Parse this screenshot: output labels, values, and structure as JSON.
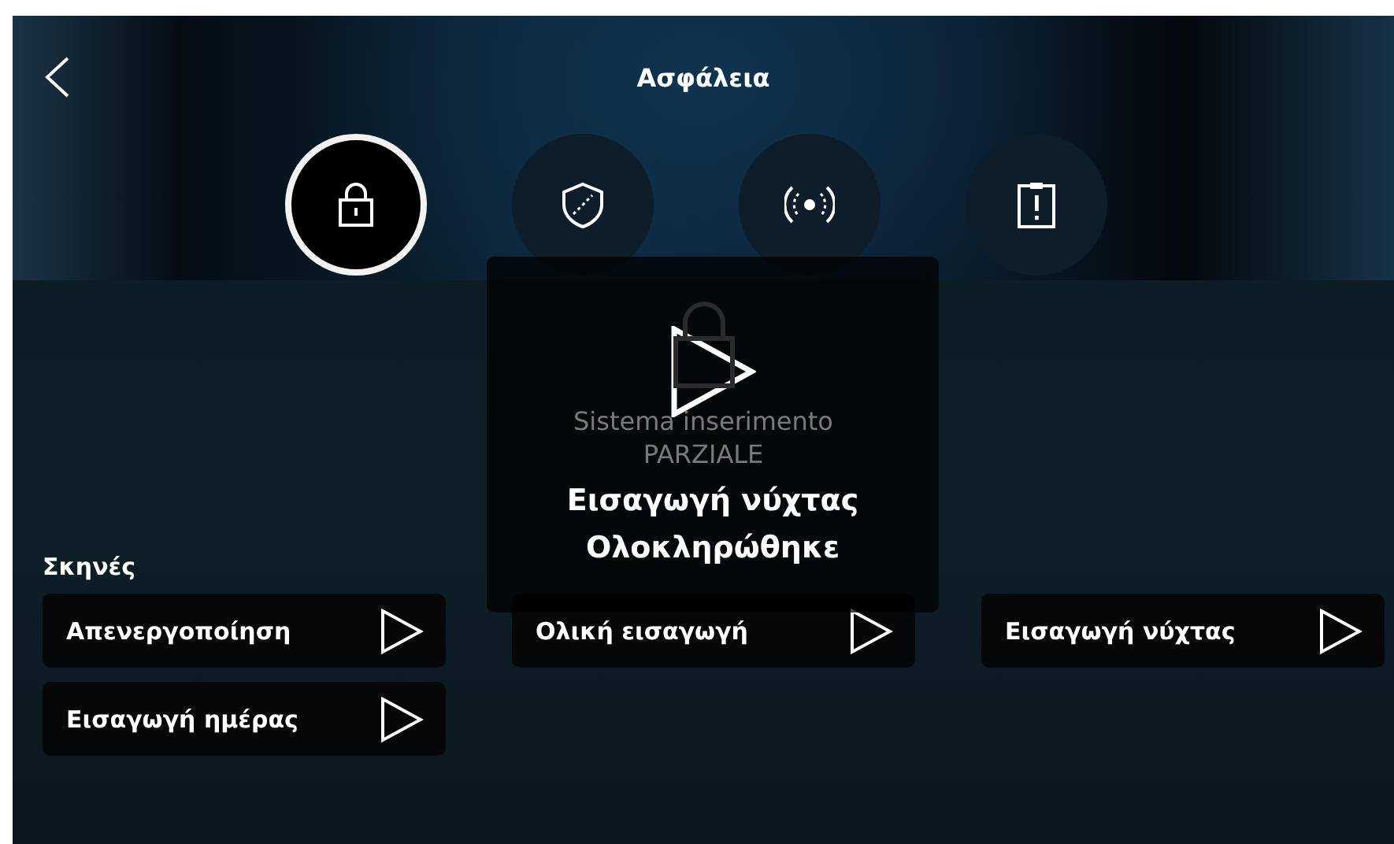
{
  "header": {
    "title": "Ασφάλεια"
  },
  "tabs": [
    {
      "kind": "lock",
      "selected": true
    },
    {
      "kind": "shield",
      "selected": false
    },
    {
      "kind": "signal",
      "selected": false
    },
    {
      "kind": "clipboard",
      "selected": false
    }
  ],
  "status": {
    "lines": [
      "Sistema inserimento",
      "PARZIALE"
    ]
  },
  "scenes": {
    "label": "Σκηνές",
    "columns": [
      {
        "items": [
          {
            "label": "Απενεργοποίηση"
          },
          {
            "label": "Εισαγωγή ημέρας"
          }
        ]
      },
      {
        "items": [
          {
            "label": "Ολική εισαγωγή"
          }
        ]
      },
      {
        "items": [
          {
            "label": "Εισαγωγή νύχτας"
          }
        ]
      }
    ]
  },
  "toast": {
    "lines": [
      "Εισαγωγή νύχτας",
      "Ολοκληρώθηκε"
    ]
  }
}
